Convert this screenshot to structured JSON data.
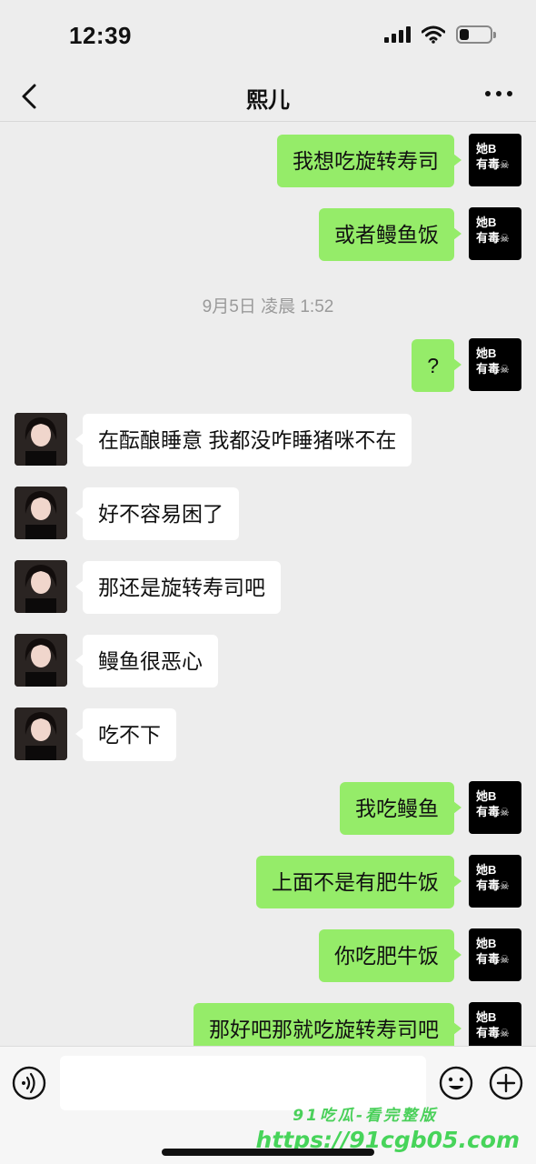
{
  "status_bar": {
    "time": "12:39"
  },
  "nav": {
    "title": "熙儿"
  },
  "my_avatar": {
    "line1": "她B",
    "line2": "有毒",
    "skull": "☠"
  },
  "messages": [
    {
      "from": "me",
      "text": "我想吃旋转寿司"
    },
    {
      "from": "me",
      "text": "或者鳗鱼饭"
    },
    {
      "type": "time",
      "text": "9月5日 凌晨 1:52"
    },
    {
      "from": "me",
      "text": "?"
    },
    {
      "from": "them",
      "text": "在酝酿睡意 我都没咋睡猪咪不在"
    },
    {
      "from": "them",
      "text": "好不容易困了"
    },
    {
      "from": "them",
      "text": "那还是旋转寿司吧"
    },
    {
      "from": "them",
      "text": "鳗鱼很恶心"
    },
    {
      "from": "them",
      "text": "吃不下"
    },
    {
      "from": "me",
      "text": "我吃鳗鱼"
    },
    {
      "from": "me",
      "text": "上面不是有肥牛饭"
    },
    {
      "from": "me",
      "text": "你吃肥牛饭"
    },
    {
      "from": "me",
      "text": "那好吧那就吃旋转寿司吧"
    }
  ],
  "input": {
    "value": ""
  },
  "watermark": {
    "line1": "91吃瓜-看完整版",
    "line2": "https://91cgb05.com"
  },
  "colors": {
    "my_bubble": "#95ec69",
    "their_bubble": "#ffffff",
    "background": "#ededed"
  }
}
